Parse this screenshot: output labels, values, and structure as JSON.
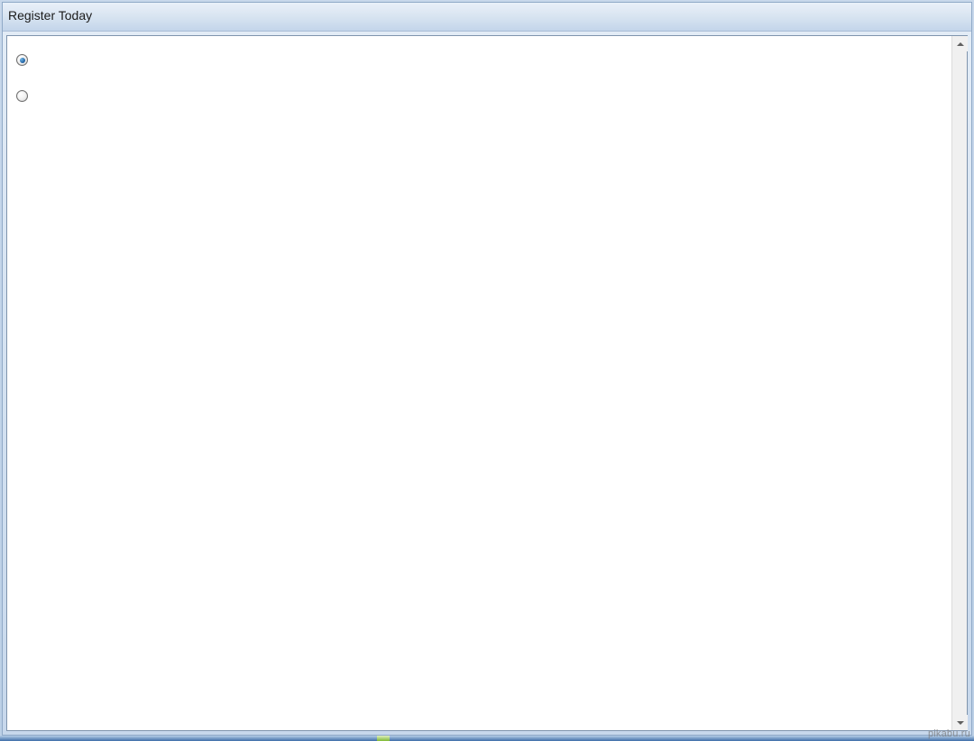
{
  "window": {
    "title": "Register Today"
  },
  "options": [
    {
      "selected": true,
      "label": ""
    },
    {
      "selected": false,
      "label": ""
    }
  ],
  "watermark": "pikabu.ru"
}
